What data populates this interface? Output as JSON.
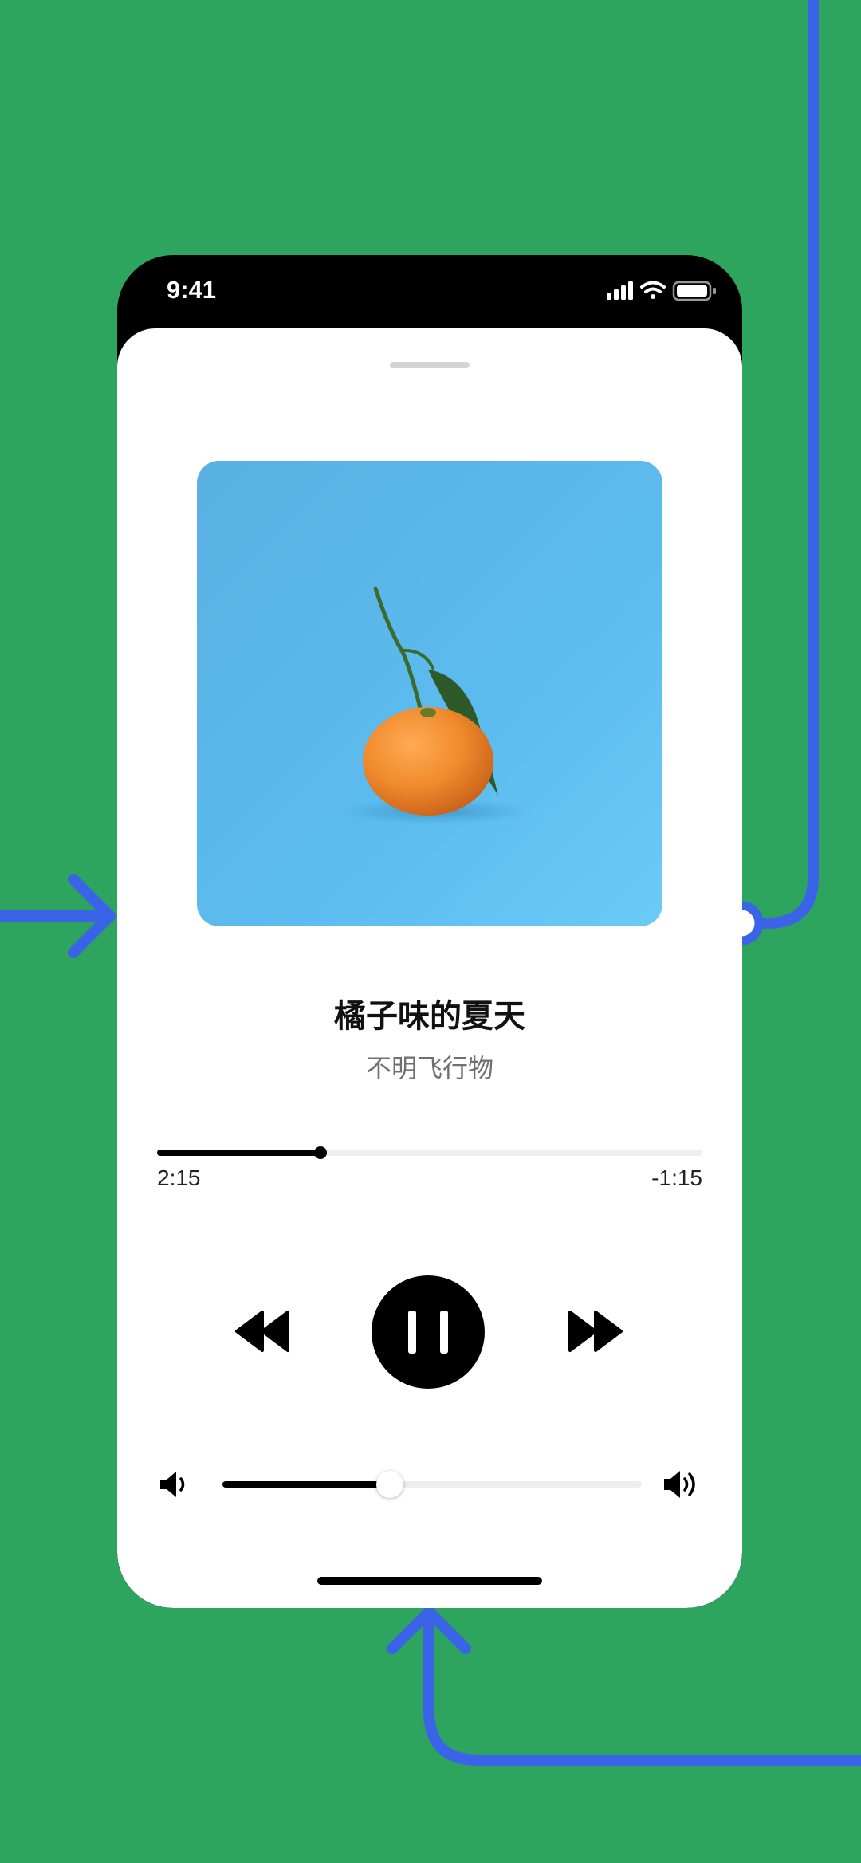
{
  "status_bar": {
    "time": "9:41",
    "icons": [
      "cellular-signal-icon",
      "wifi-icon",
      "battery-icon"
    ]
  },
  "now_playing": {
    "artwork": "album-art-mandarin-orange-on-blue",
    "title": "橘子味的夏天",
    "artist": "不明飞行物"
  },
  "playback": {
    "elapsed": "2:15",
    "remaining": "-1:15",
    "progress_fraction": 0.3,
    "state": "playing"
  },
  "controls": {
    "icons": [
      "rewind-icon",
      "pause-icon",
      "fast-forward-icon"
    ]
  },
  "volume": {
    "level_fraction": 0.4,
    "icons": [
      "volume-low-icon",
      "volume-high-icon"
    ]
  },
  "colors": {
    "background": "#2da55e",
    "connector": "#3b63e8",
    "artwork_sky": "#5ab8ec",
    "orange": "#f08a2c"
  }
}
